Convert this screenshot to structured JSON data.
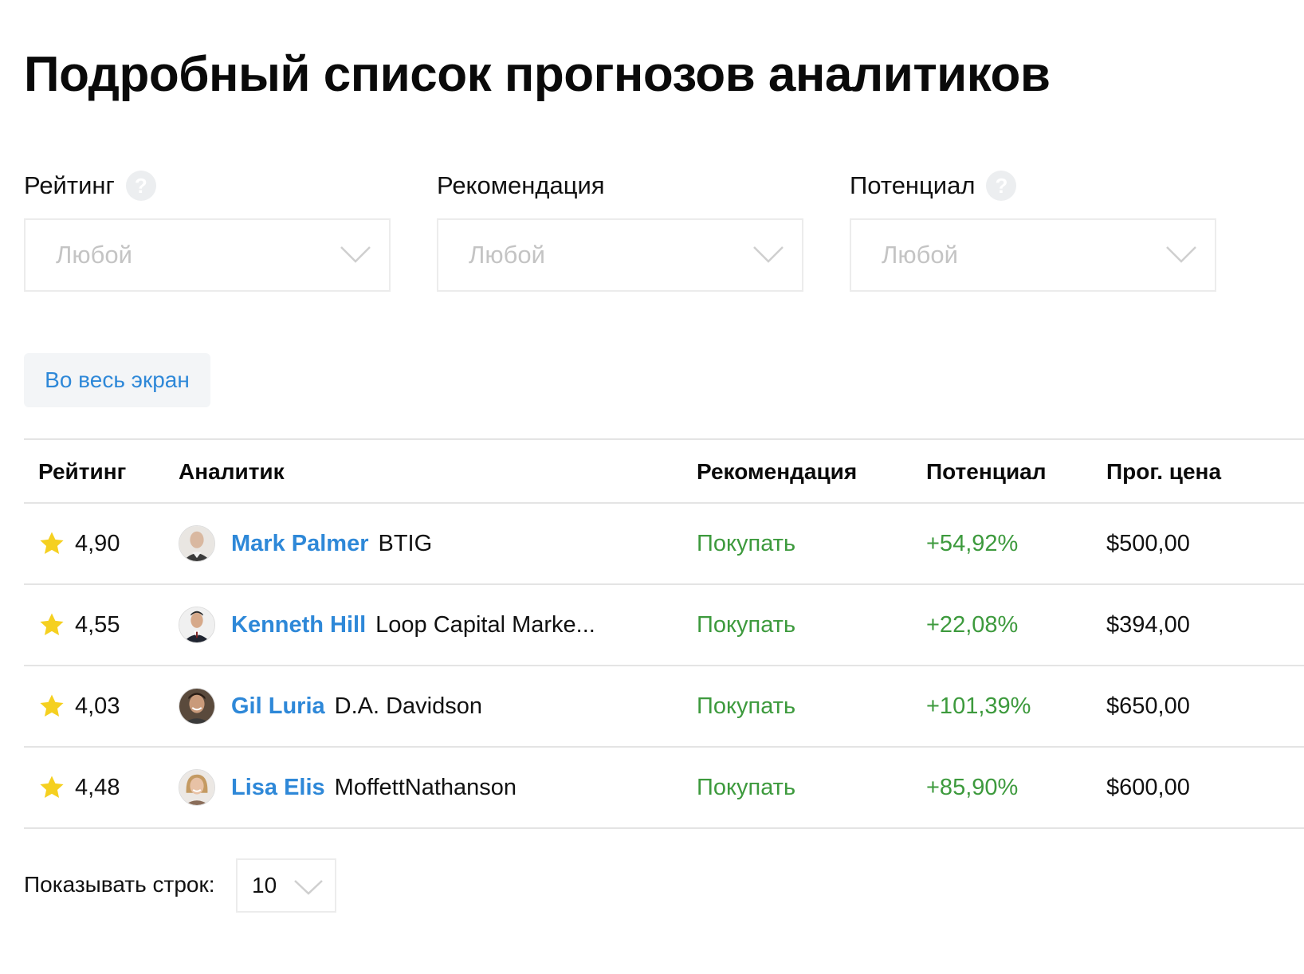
{
  "page": {
    "title": "Подробный список прогнозов аналитиков"
  },
  "filters": [
    {
      "label": "Рейтинг",
      "value": "Любой",
      "has_help": true
    },
    {
      "label": "Рекомендация",
      "value": "Любой",
      "has_help": false
    },
    {
      "label": "Потенциал",
      "value": "Любой",
      "has_help": true
    }
  ],
  "help_icon_glyph": "?",
  "fullscreen_button": "Во весь экран",
  "table": {
    "headers": {
      "rating": "Рейтинг",
      "analyst": "Аналитик",
      "recommendation": "Рекомендация",
      "upside": "Потенциал",
      "target_price": "Прог. цена"
    },
    "rows": [
      {
        "rating": "4,90",
        "name": "Mark Palmer",
        "firm": "BTIG",
        "recommendation": "Покупать",
        "upside": "+54,92%",
        "target_price": "$500,00"
      },
      {
        "rating": "4,55",
        "name": "Kenneth Hill",
        "firm": "Loop Capital Marke...",
        "recommendation": "Покупать",
        "upside": "+22,08%",
        "target_price": "$394,00"
      },
      {
        "rating": "4,03",
        "name": "Gil Luria",
        "firm": "D.A. Davidson",
        "recommendation": "Покупать",
        "upside": "+101,39%",
        "target_price": "$650,00"
      },
      {
        "rating": "4,48",
        "name": "Lisa Elis",
        "firm": "MoffettNathanson",
        "recommendation": "Покупать",
        "upside": "+85,90%",
        "target_price": "$600,00"
      }
    ]
  },
  "pagination": {
    "rows_label": "Показывать строк:",
    "rows_value": "10"
  },
  "colors": {
    "link": "#2e88d8",
    "positive": "#3d9a3d",
    "star": "#f5d020"
  },
  "icons": {
    "rating_star": "star-icon",
    "dropdown": "chevron-down-icon",
    "help": "help-icon",
    "avatar": "avatar"
  }
}
